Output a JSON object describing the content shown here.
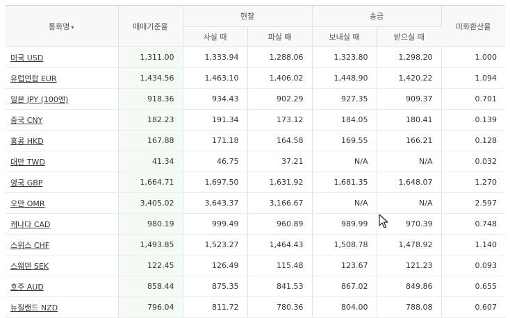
{
  "header": {
    "currency_label": "통화명",
    "sort_icon": "▾",
    "base_rate_label": "매매기준율",
    "cash_label": "현찰",
    "cash_buy_label": "사실 때",
    "cash_sell_label": "파실 때",
    "transfer_label": "송금",
    "transfer_send_label": "보내실 때",
    "transfer_receive_label": "받으실 때",
    "usd_rate_label": "미화환산율"
  },
  "rows": [
    {
      "name": "미국 USD",
      "base": "1,311.00",
      "buy": "1,333.94",
      "sell": "1,288.06",
      "send": "1,323.80",
      "receive": "1,298.20",
      "usd": "1.000"
    },
    {
      "name": "유럽연합 EUR",
      "base": "1,434.56",
      "buy": "1,463.10",
      "sell": "1,406.02",
      "send": "1,448.90",
      "receive": "1,420.22",
      "usd": "1.094"
    },
    {
      "name": "일본 JPY (100엔)",
      "base": "918.36",
      "buy": "934.43",
      "sell": "902.29",
      "send": "927.35",
      "receive": "909.37",
      "usd": "0.701"
    },
    {
      "name": "중국 CNY",
      "base": "182.23",
      "buy": "191.34",
      "sell": "173.12",
      "send": "184.05",
      "receive": "180.41",
      "usd": "0.139"
    },
    {
      "name": "홍콩 HKD",
      "base": "167.88",
      "buy": "171.18",
      "sell": "164.58",
      "send": "169.55",
      "receive": "166.21",
      "usd": "0.128"
    },
    {
      "name": "대만 TWD",
      "base": "41.34",
      "buy": "46.75",
      "sell": "37.21",
      "send": "N/A",
      "receive": "N/A",
      "usd": "0.032"
    },
    {
      "name": "영국 GBP",
      "base": "1,664.71",
      "buy": "1,697.50",
      "sell": "1,631.92",
      "send": "1,681.35",
      "receive": "1,648.07",
      "usd": "1.270"
    },
    {
      "name": "오만 OMR",
      "base": "3,405.02",
      "buy": "3,643.37",
      "sell": "3,166.67",
      "send": "N/A",
      "receive": "N/A",
      "usd": "2.597"
    },
    {
      "name": "캐나다 CAD",
      "base": "980.19",
      "buy": "999.49",
      "sell": "960.89",
      "send": "989.99",
      "receive": "970.39",
      "usd": "0.748"
    },
    {
      "name": "스위스 CHF",
      "base": "1,493.85",
      "buy": "1,523.27",
      "sell": "1,464.43",
      "send": "1,508.78",
      "receive": "1,478.92",
      "usd": "1.140"
    },
    {
      "name": "스웨덴 SEK",
      "base": "122.45",
      "buy": "126.49",
      "sell": "115.48",
      "send": "123.67",
      "receive": "121.23",
      "usd": "0.093"
    },
    {
      "name": "호주 AUD",
      "base": "858.44",
      "buy": "875.35",
      "sell": "841.53",
      "send": "867.02",
      "receive": "849.86",
      "usd": "0.655"
    },
    {
      "name": "뉴질랜드 NZD",
      "base": "796.04",
      "buy": "811.72",
      "sell": "780.36",
      "send": "804.00",
      "receive": "788.08",
      "usd": "0.607"
    }
  ],
  "colors": {
    "base_column_bg": "#f4faf4",
    "header_bg": "#f8f8f8",
    "border": "#e2e2e2"
  },
  "cursor_icon": "mouse-pointer-icon"
}
